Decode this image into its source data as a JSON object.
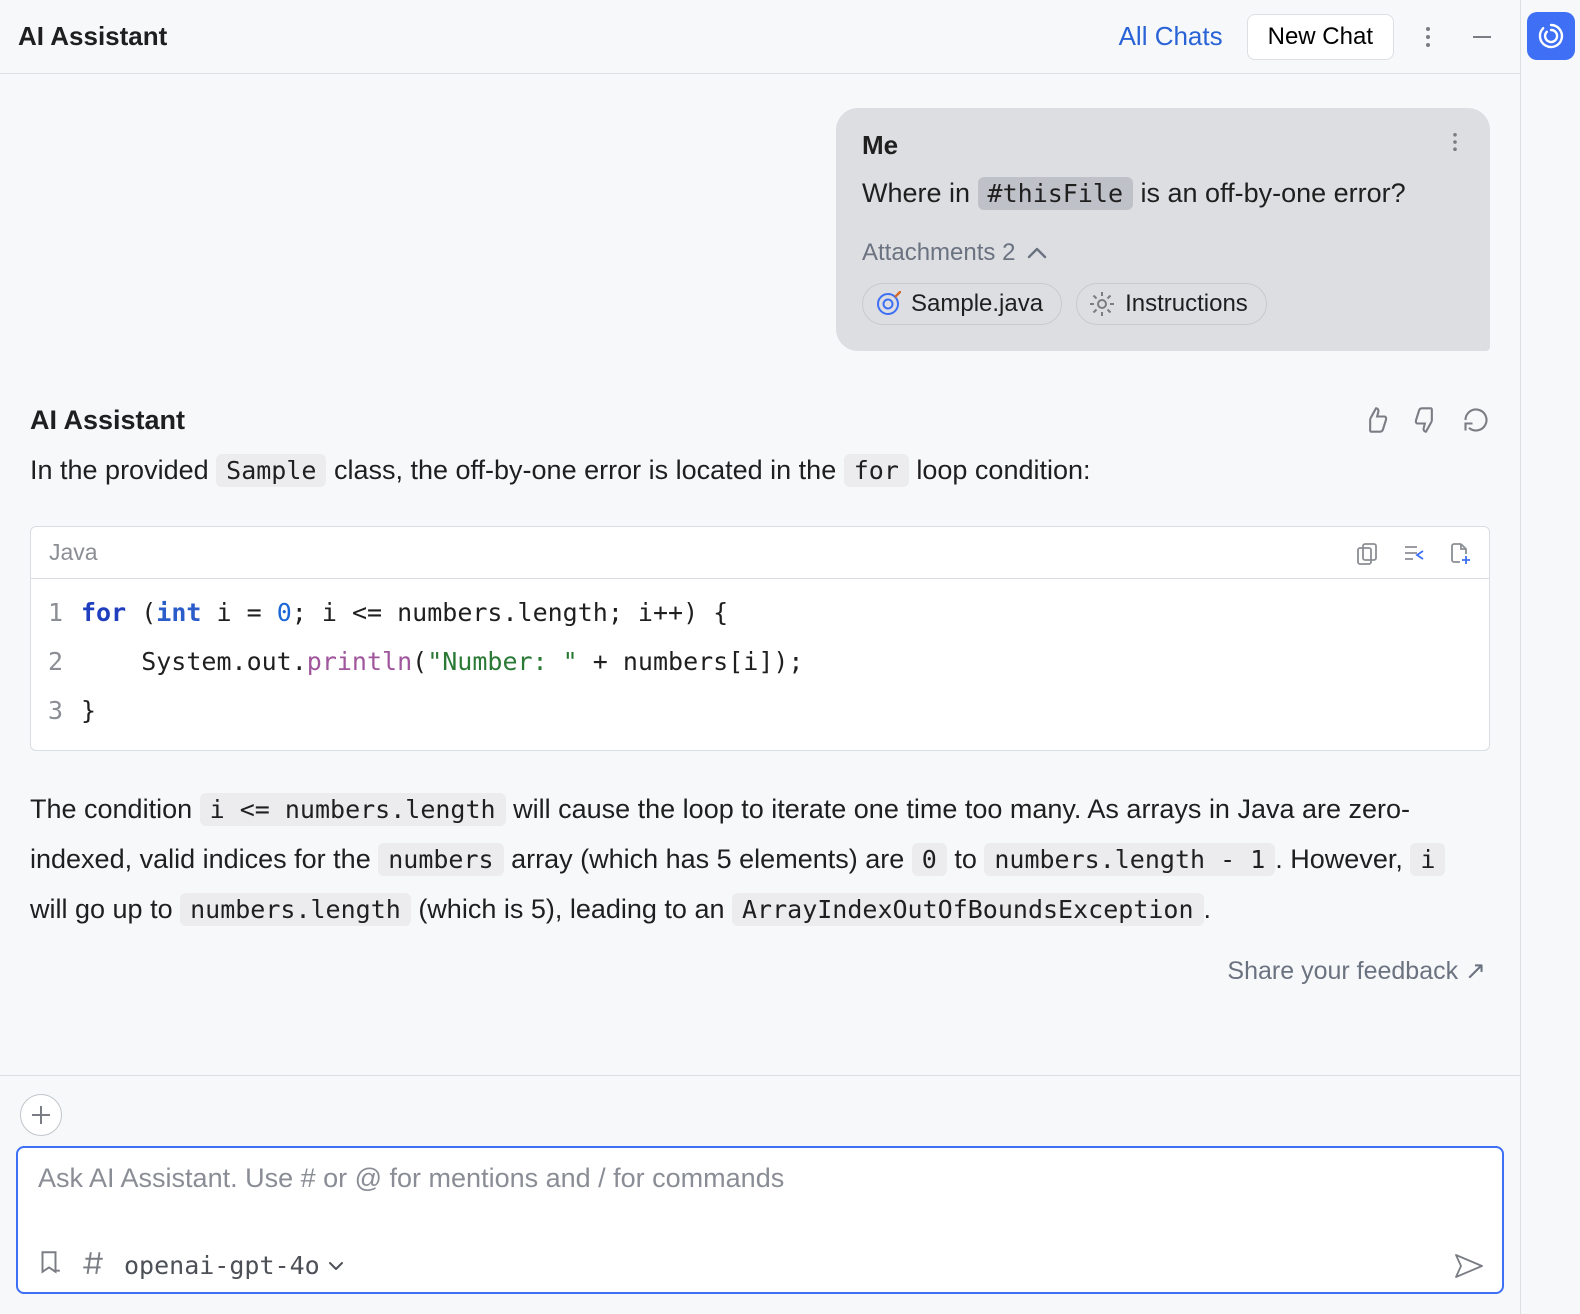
{
  "header": {
    "title": "AI Assistant",
    "all_chats": "All Chats",
    "new_chat": "New Chat"
  },
  "user_message": {
    "author": "Me",
    "text_before": "Where in ",
    "mention": "#thisFile",
    "text_after": " is an off-by-one error?",
    "attachments_label": "Attachments 2",
    "chips": [
      {
        "label": "Sample.java"
      },
      {
        "label": "Instructions"
      }
    ]
  },
  "assistant": {
    "title": "AI Assistant",
    "intro_parts": {
      "p1": "In the provided ",
      "c1": "Sample",
      "p2": " class, the off-by-one error is located in the ",
      "c2": "for",
      "p3": " loop condition:"
    },
    "code": {
      "language": "Java",
      "lines": [
        "for (int i = 0; i <= numbers.length; i++) {",
        "    System.out.println(\"Number: \" + numbers[i]);",
        "}"
      ]
    },
    "explain": {
      "p1": "The condition ",
      "c1": "i <= numbers.length",
      "p2": " will cause the loop to iterate one time too many. As arrays in Java are zero-indexed, valid indices for the ",
      "c2": "numbers",
      "p3": " array (which has 5 elements) are ",
      "c3": "0",
      "p4": " to ",
      "c4": "numbers.length - 1",
      "p5": ". However, ",
      "c5": "i",
      "p6": " will go up to ",
      "c6": "numbers.length",
      "p7": " (which is 5), leading to an ",
      "c7": "ArrayIndexOutOfBoundsException",
      "p8": "."
    },
    "feedback_link": "Share your feedback ↗"
  },
  "composer": {
    "placeholder": "Ask AI Assistant. Use # or @ for mentions and / for commands",
    "model": "openai-gpt-4o"
  }
}
